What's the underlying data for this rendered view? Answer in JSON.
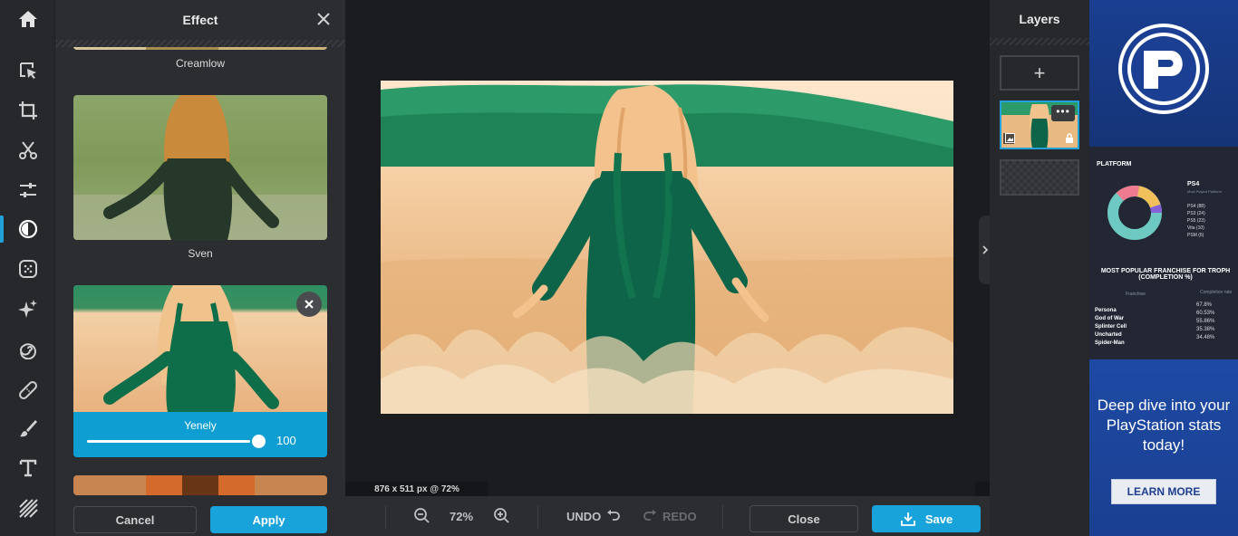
{
  "rail": {
    "tools": [
      {
        "name": "home-icon"
      },
      {
        "name": "select-icon"
      },
      {
        "name": "crop-icon"
      },
      {
        "name": "scissors-icon"
      },
      {
        "name": "adjust-icon"
      },
      {
        "name": "effect-icon",
        "active": true
      },
      {
        "name": "filter-icon"
      },
      {
        "name": "sparkle-icon"
      },
      {
        "name": "spiral-icon"
      },
      {
        "name": "bandage-icon"
      },
      {
        "name": "brush-icon"
      },
      {
        "name": "text-icon"
      },
      {
        "name": "pattern-icon"
      }
    ],
    "accent": "#21a1d8"
  },
  "effect": {
    "title": "Effect",
    "items": [
      {
        "label": "Creamlow"
      },
      {
        "label": "Sven"
      },
      {
        "label": "Yenely",
        "selected": true,
        "intensity": "100"
      }
    ],
    "cancel_label": "Cancel",
    "apply_label": "Apply"
  },
  "canvas": {
    "dimensions": "876 x 511 px @ 72%"
  },
  "toolbar": {
    "zoom": "72%",
    "undo_label": "UNDO",
    "redo_label": "REDO",
    "close_label": "Close",
    "save_label": "Save"
  },
  "layers": {
    "title": "Layers",
    "add_symbol": "+",
    "more_symbol": "•••"
  },
  "ad": {
    "platform_label": "PLATFORM",
    "platform_name": "PS4",
    "platform_sub": "Most Played Platform",
    "legend": [
      "PS4 (88)",
      "PS3 (24)",
      "PS5 (23)",
      "Vita (10)",
      "PSM (6)"
    ],
    "franchise_title": "MOST POPULAR FRANCHISE FOR TROPH (COMPLETION %)",
    "col_a": "Franchise",
    "col_b": "Completion rate",
    "franchises": [
      {
        "name": "Persona",
        "value": "67.8%"
      },
      {
        "name": "God of War",
        "value": "60.53%"
      },
      {
        "name": "Splinter Cell",
        "value": "55.86%"
      },
      {
        "name": "Uncharted",
        "value": "35.38%"
      },
      {
        "name": "Spider-Man",
        "value": "34.48%"
      }
    ],
    "headline": "Deep dive into your PlayStation stats today!",
    "cta": "LEARN MORE"
  }
}
